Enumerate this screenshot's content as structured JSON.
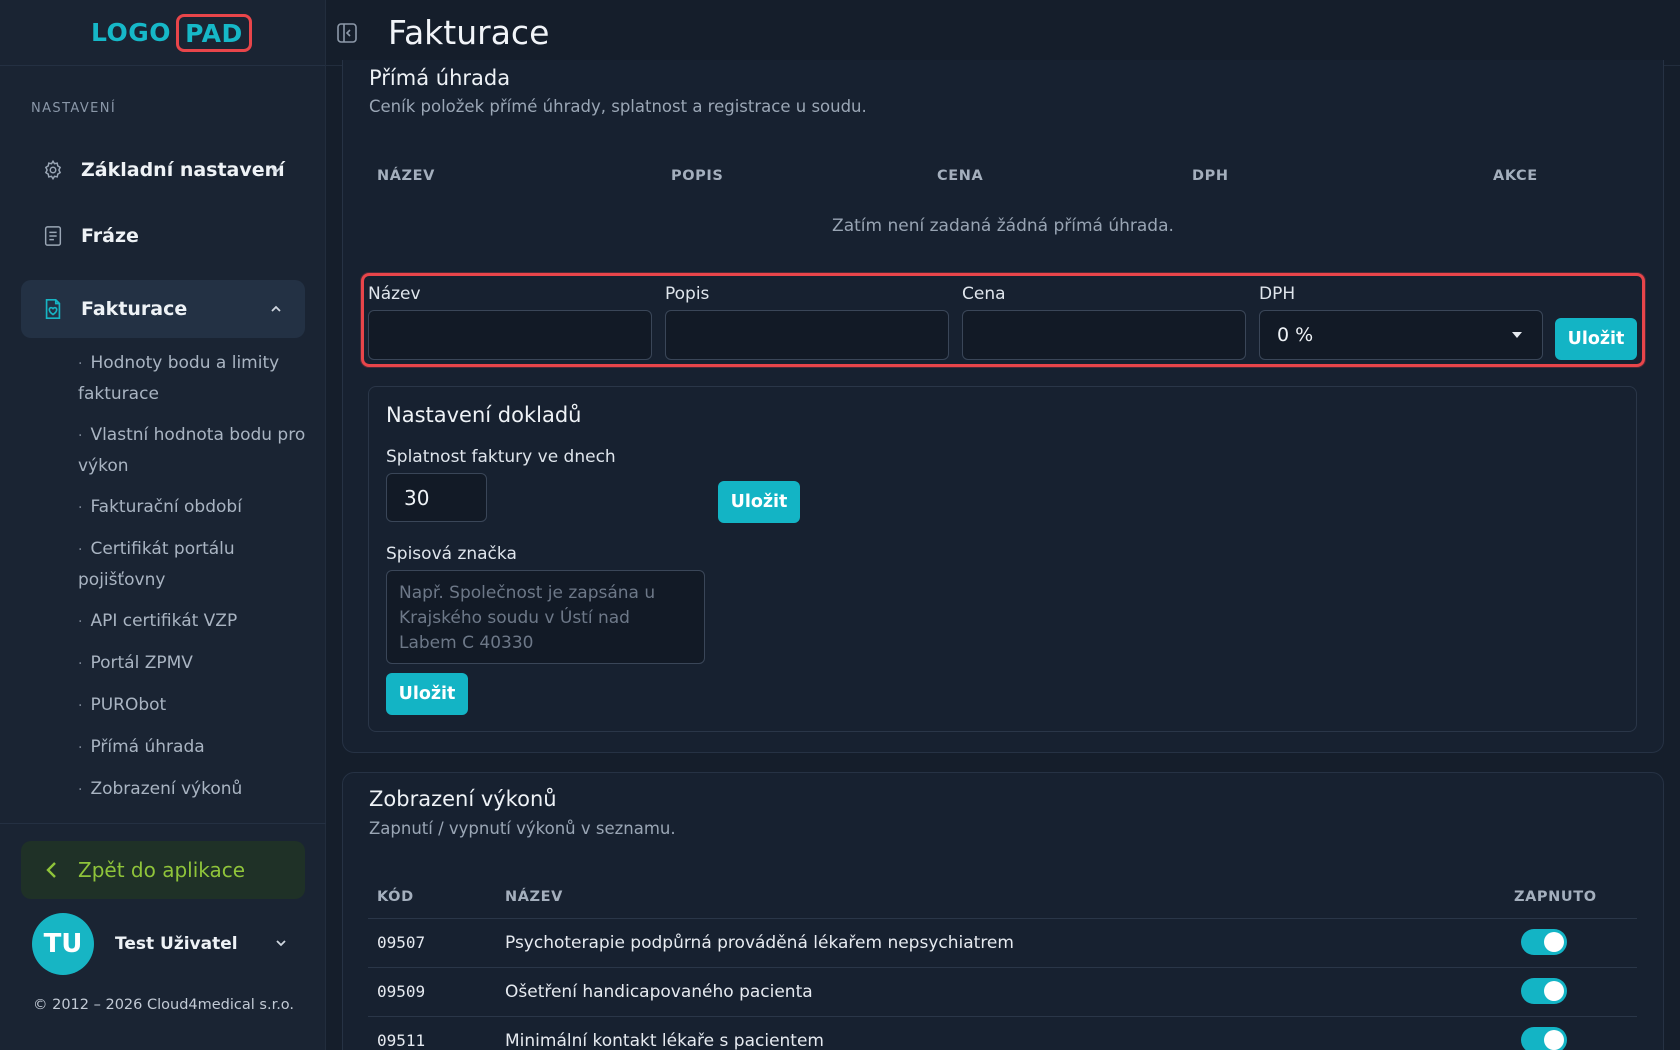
{
  "logo": {
    "part1": "LOGO",
    "part2": "PAD"
  },
  "sidebar": {
    "section_label": "NASTAVENÍ",
    "items": [
      {
        "label": "Základní nastavení",
        "icon": "gear-icon"
      },
      {
        "label": "Fráze",
        "icon": "document-icon"
      },
      {
        "label": "Fakturace",
        "icon": "invoice-icon"
      }
    ],
    "sub_items": [
      {
        "label": "Hodnoty bodu a limity fakturace"
      },
      {
        "label": "Vlastní hodnota bodu pro výkon"
      },
      {
        "label": "Fakturační období"
      },
      {
        "label": "Certifikát portálu pojišťovny"
      },
      {
        "label": "API certifikát VZP"
      },
      {
        "label": "Portál ZPMV"
      },
      {
        "label": "PURObot"
      },
      {
        "label": "Přímá úhrada"
      },
      {
        "label": "Zobrazení výkonů"
      }
    ],
    "back_label": "Zpět do aplikace",
    "user": {
      "initials": "TU",
      "name": "Test Uživatel"
    },
    "copyright": "© 2012 – 2026 Cloud4medical s.r.o."
  },
  "header": {
    "title": "Fakturace"
  },
  "prima_uhrada": {
    "title": "Přímá úhrada",
    "description": "Ceník položek přímé úhrady, splatnost a registrace u soudu.",
    "columns": [
      "NÁZEV",
      "POPIS",
      "CENA",
      "DPH",
      "AKCE"
    ],
    "empty_text": "Zatím není zadaná žádná přímá úhrada.",
    "form": {
      "name_label": "Název",
      "name_value": "",
      "description_label": "Popis",
      "description_value": "",
      "price_label": "Cena",
      "price_value": "",
      "vat_label": "DPH",
      "vat_value": "0 %",
      "save_label": "Uložit"
    }
  },
  "nastaveni_dokladu": {
    "title": "Nastavení dokladů",
    "due_label": "Splatnost faktury ve dnech",
    "due_value": "30",
    "save_label": "Uložit",
    "file_label": "Spisová značka",
    "file_placeholder": "Např. Společnost je zapsána u Krajského soudu v Ústí nad Labem C 40330",
    "file_save_label": "Uložit"
  },
  "zobrazeni_vykonu": {
    "title": "Zobrazení výkonů",
    "description": "Zapnutí / vypnutí výkonů v seznamu.",
    "columns": [
      "KÓD",
      "NÁZEV",
      "ZAPNUTO"
    ],
    "rows": [
      {
        "code": "09507",
        "name": "Psychoterapie podpůrná prováděná lékařem nepsychiatrem",
        "enabled": true
      },
      {
        "code": "09509",
        "name": "Ošetření handicapovaného pacienta",
        "enabled": true
      },
      {
        "code": "09511",
        "name": "Minimální kontakt lékaře s pacientem",
        "enabled": true
      }
    ]
  },
  "colors": {
    "accent": "#13b4c5",
    "highlight": "#e8454a",
    "back_text": "#8fc43a"
  }
}
